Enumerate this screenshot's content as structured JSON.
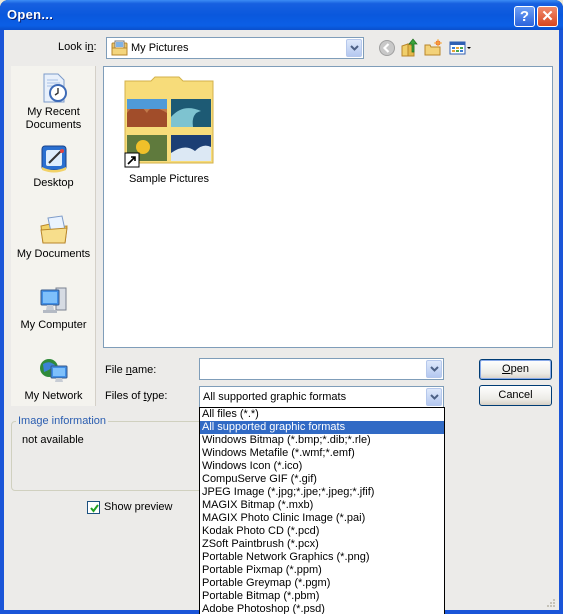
{
  "window": {
    "title": "Open...",
    "help_button": "?",
    "close_button": "✕"
  },
  "look_in": {
    "label": "Look in:",
    "value": "My Pictures",
    "icon": "my-pictures-folder-icon"
  },
  "toolbar": {
    "back_icon": "back-arrow-icon",
    "up_icon": "up-folder-icon",
    "new_folder_icon": "new-folder-icon",
    "views_icon": "views-menu-icon"
  },
  "places": [
    {
      "label_line1": "My Recent",
      "label_line2": "Documents",
      "icon": "recent-documents-icon"
    },
    {
      "label_line1": "Desktop",
      "label_line2": "",
      "icon": "desktop-icon"
    },
    {
      "label_line1": "My Documents",
      "label_line2": "",
      "icon": "my-documents-icon"
    },
    {
      "label_line1": "My Computer",
      "label_line2": "",
      "icon": "my-computer-icon"
    },
    {
      "label_line1": "My Network",
      "label_line2": "",
      "icon": "my-network-icon"
    }
  ],
  "files": [
    {
      "name": "Sample Pictures",
      "type": "folder-shortcut"
    }
  ],
  "file_name": {
    "label": "File name:",
    "value": ""
  },
  "file_type": {
    "label": "Files of type:",
    "value": "All supported graphic formats",
    "options": [
      "All files (*.*)",
      "All supported graphic formats",
      "Windows Bitmap (*.bmp;*.dib;*.rle)",
      "Windows Metafile (*.wmf;*.emf)",
      "Windows Icon (*.ico)",
      "CompuServe GIF (*.gif)",
      "JPEG Image (*.jpg;*.jpe;*.jpeg;*.jfif)",
      "MAGIX Bitmap (*.mxb)",
      "MAGIX Photo Clinic Image (*.pai)",
      "Kodak Photo CD (*.pcd)",
      "ZSoft Paintbrush (*.pcx)",
      "Portable Network Graphics (*.png)",
      "Portable Pixmap (*.ppm)",
      "Portable Greymap (*.pgm)",
      "Portable Bitmap (*.pbm)",
      "Adobe Photoshop (*.psd)"
    ],
    "selected_index": 1
  },
  "buttons": {
    "open": "Open",
    "cancel": "Cancel"
  },
  "image_info": {
    "title": "Image information",
    "value": "not available"
  },
  "show_preview": {
    "label": "Show preview",
    "checked": true
  },
  "colors": {
    "title_bar": "#0a58dd",
    "selection": "#316ac5",
    "group_title": "#2a5db0"
  }
}
